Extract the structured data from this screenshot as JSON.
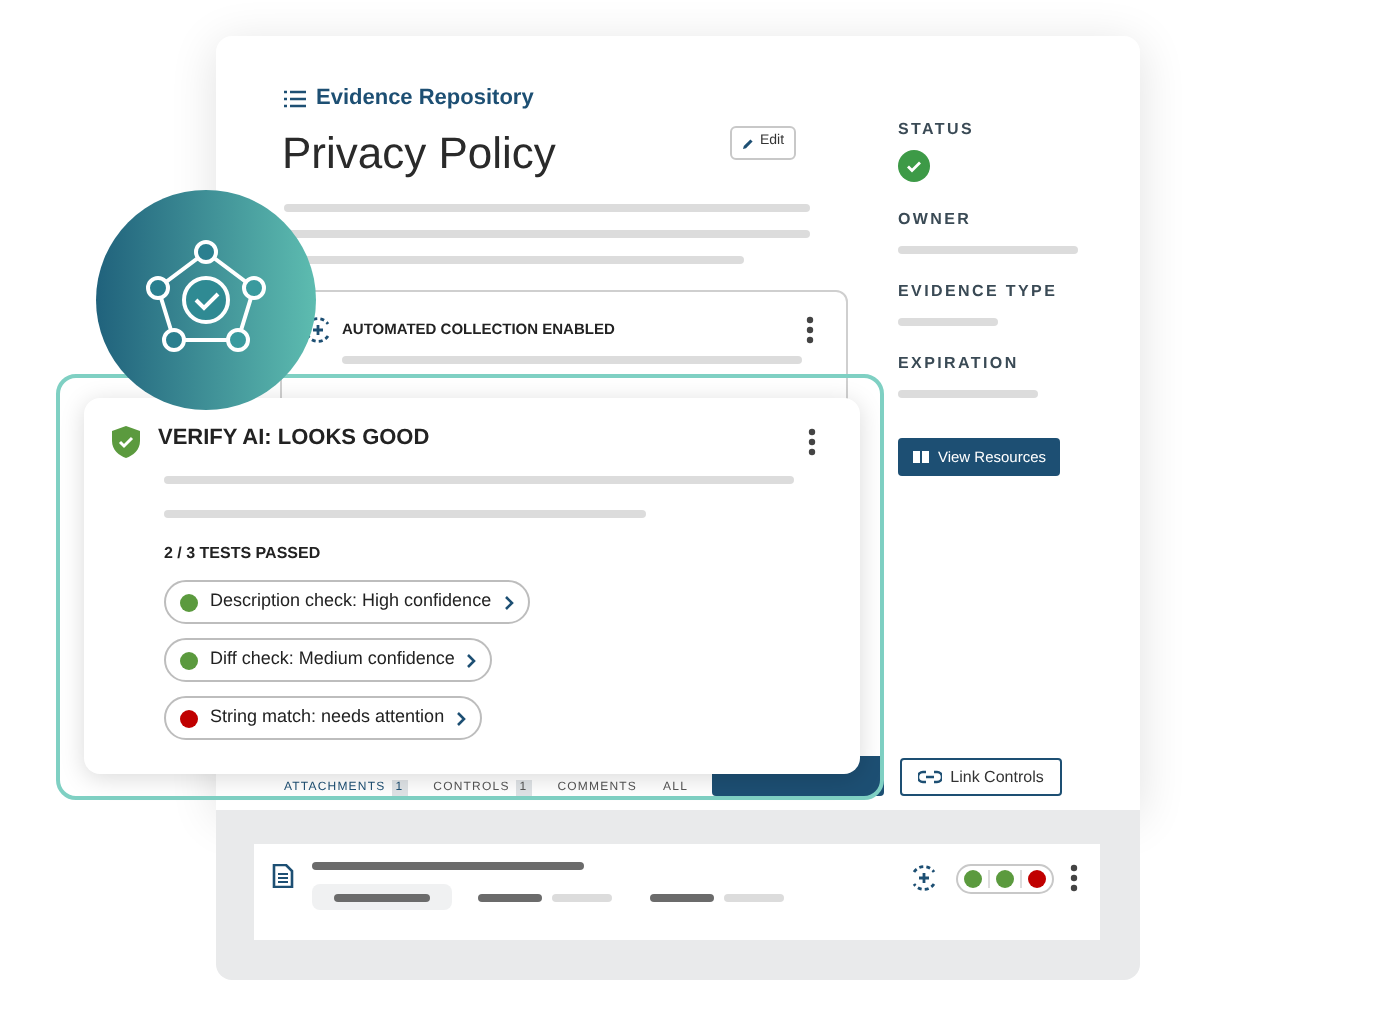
{
  "breadcrumb": "Evidence Repository",
  "title": "Privacy Policy",
  "edit_button": "Edit",
  "sidebar": {
    "fields": [
      {
        "label": "STATUS",
        "kind": "status"
      },
      {
        "label": "OWNER",
        "kind": "line"
      },
      {
        "label": "EVIDENCE TYPE",
        "kind": "line"
      },
      {
        "label": "EXPIRATION",
        "kind": "line"
      }
    ],
    "resources_button": "View Resources"
  },
  "automation_card": {
    "title": "AUTOMATED COLLECTION ENABLED"
  },
  "verify_card": {
    "title": "VERIFY AI: LOOKS GOOD",
    "summary": "2 / 3 TESTS PASSED",
    "tests": [
      {
        "label": "Description check: High confidence",
        "color": "#5b9a3e"
      },
      {
        "label": "Diff check: Medium confidence",
        "color": "#5b9a3e"
      },
      {
        "label": "String match: needs attention",
        "color": "#c00000"
      }
    ]
  },
  "tabs": [
    {
      "label": "ATTACHMENTS",
      "count": "1",
      "selected": true
    },
    {
      "label": "CONTROLS",
      "count": "1",
      "selected": false
    },
    {
      "label": "COMMENTS",
      "selected": false
    },
    {
      "label": "ALL",
      "selected": false
    }
  ],
  "link_button": "Link Controls",
  "evidence_row": {
    "status_dots": [
      {
        "color": "#5b9a3e"
      },
      {
        "color": "#5b9a3e"
      },
      {
        "color": "#c00000"
      }
    ]
  }
}
